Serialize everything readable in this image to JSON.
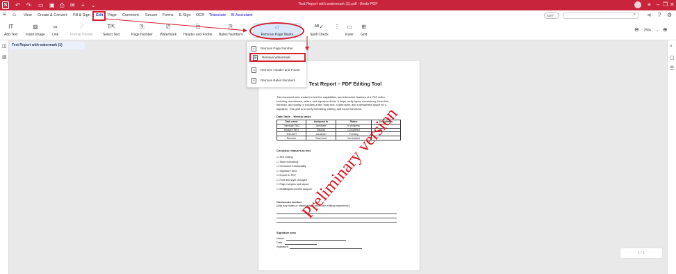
{
  "window": {
    "title": "Test Report with watermark (1).pdf - Bedo PDF",
    "app_letter": "S"
  },
  "menu": {
    "items": [
      "View",
      "Create & Convert",
      "Fill & Sign",
      "Edit",
      "Page",
      "Comment",
      "Secure",
      "Forms",
      "E-Sign",
      "OCR",
      "Translate",
      "AI Assistant"
    ],
    "edit_mode_label": "EDIT"
  },
  "toolbar": {
    "tools": [
      "Add Text",
      "Insert Image",
      "Link",
      "Format Painter",
      "Select Text",
      "Page Number",
      "Watermark",
      "Header and Footer",
      "Bates Numbers",
      "Remove Page Marks",
      "Spell Check",
      "Ruler",
      "Grid"
    ],
    "zoom": "75%"
  },
  "file_tab": "Test Report with watermark (1)",
  "dropdown": {
    "items": [
      "Remove Page Number",
      "Remove Watermark",
      "Remove Header and Footer",
      "Remove Bates Numbers"
    ]
  },
  "document": {
    "title": "Test Report – PDF Editing Tool",
    "intro": [
      "This document was created to test the capabilities, and interactive features of a PDF editor,",
      "including checkboxes, tables, and signature fields. It helps verify layout consistency, form field",
      "behavior, and quality. It includes a title, body text, a data table, and a designated space for a",
      "signature. This goal is to verify formatting, editing, and export functions."
    ],
    "table_heading": "Data Table – Weekly tasks",
    "table": {
      "headers": [
        "Task name",
        "Assigned to",
        "Status",
        "Completion"
      ],
      "rows": [
        [
          "Translate FAQ",
          "Iamdvate",
          "In progress",
          ""
        ],
        [
          "Analyze SEO",
          "Nicolas",
          "Completed",
          ""
        ],
        [
          "Test ACR",
          "Jonathan",
          "Pending",
          ""
        ],
        [
          "Rename",
          "Team lead",
          "Not started",
          ""
        ]
      ]
    },
    "checklist_heading": "Checklist: features to test",
    "checklist": [
      "Text editing",
      "Table formatting",
      "Checkbox functionality",
      "Signature field",
      "Export to PDF",
      "Font and style changes",
      "Page margins and layout",
      "Multilingual content support"
    ],
    "comments_heading": "Comments section",
    "comments_hint": "(Add any notes or observations about the editing experience.)",
    "signature_heading": "Signature area",
    "signature_fields": [
      "Name:",
      "Date:",
      "Signature:"
    ]
  },
  "watermark_text": "Preliminary version",
  "pager": "1 / 1",
  "colors": {
    "titlebar": "#c8253d",
    "annotation_red": "#d41f2e",
    "watermark": "#e0141e",
    "ai_purple": "#5b4de0"
  }
}
